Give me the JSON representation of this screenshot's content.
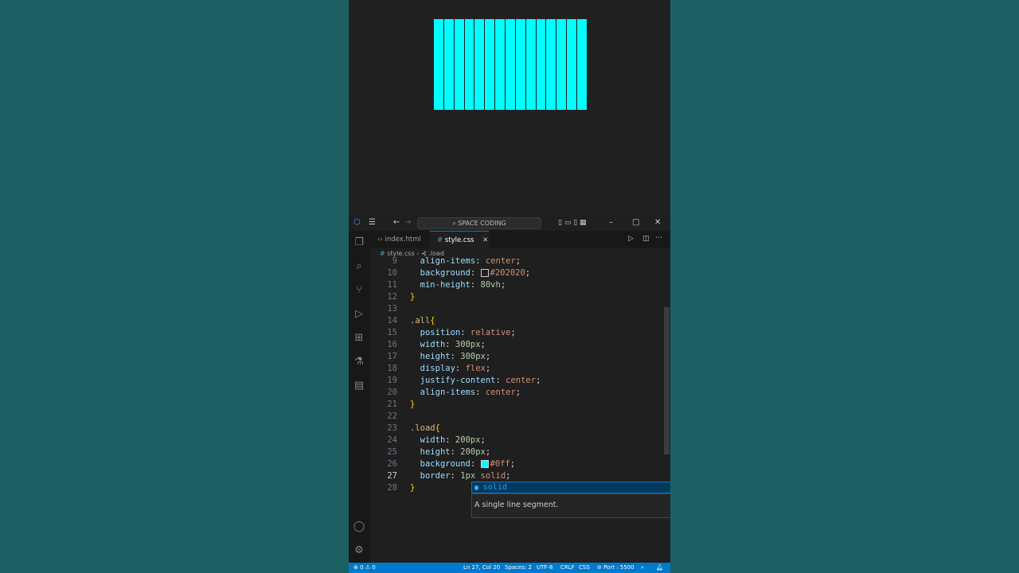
{
  "titlebar": {
    "search_text": "SPACE CODING",
    "icons": [
      "vscode-logo-icon",
      "menu-icon",
      "back-arrow-icon",
      "forward-arrow-icon",
      "layout-icons",
      "minimize-icon",
      "maximize-icon",
      "close-icon"
    ]
  },
  "tabs": [
    {
      "label": "index.html",
      "icon": "html-file-icon",
      "active": false
    },
    {
      "label": "style.css",
      "icon": "css-file-icon",
      "active": true
    }
  ],
  "breadcrumb": {
    "file": "style.css",
    "symbol": ".load"
  },
  "editor": {
    "lines": [
      {
        "n": "9",
        "text": "  align-items: center;"
      },
      {
        "n": "10",
        "text": "  background: #202020;"
      },
      {
        "n": "11",
        "text": "  min-height: 80vh;"
      },
      {
        "n": "12",
        "text": "}"
      },
      {
        "n": "13",
        "text": ""
      },
      {
        "n": "14",
        "text": ".all{"
      },
      {
        "n": "15",
        "text": "  position: relative;"
      },
      {
        "n": "16",
        "text": "  width: 300px;"
      },
      {
        "n": "17",
        "text": "  height: 300px;"
      },
      {
        "n": "18",
        "text": "  display: flex;"
      },
      {
        "n": "19",
        "text": "  justify-content: center;"
      },
      {
        "n": "20",
        "text": "  align-items: center;"
      },
      {
        "n": "21",
        "text": "}"
      },
      {
        "n": "22",
        "text": ""
      },
      {
        "n": "23",
        "text": ".load{"
      },
      {
        "n": "24",
        "text": "  width: 200px;"
      },
      {
        "n": "25",
        "text": "  height: 200px;"
      },
      {
        "n": "26",
        "text": "  background: #0ff;"
      },
      {
        "n": "27",
        "text": "  border: 1px solid;"
      },
      {
        "n": "28",
        "text": "}"
      }
    ],
    "current_line": "27"
  },
  "suggest": {
    "item": "solid",
    "doc": "A single line segment.",
    "close": "×"
  },
  "statusbar": {
    "problems": "⊗ 0 ⚠ 0",
    "position": "Ln 27, Col 20",
    "spaces": "Spaces: 2",
    "encoding": "UTF-8",
    "eol": "CRLF",
    "language": "CSS",
    "port": "⊘ Port : 5500"
  },
  "colors": {
    "preview_bg": "#202020",
    "bars": "#00ffff",
    "accent": "#007acc"
  }
}
